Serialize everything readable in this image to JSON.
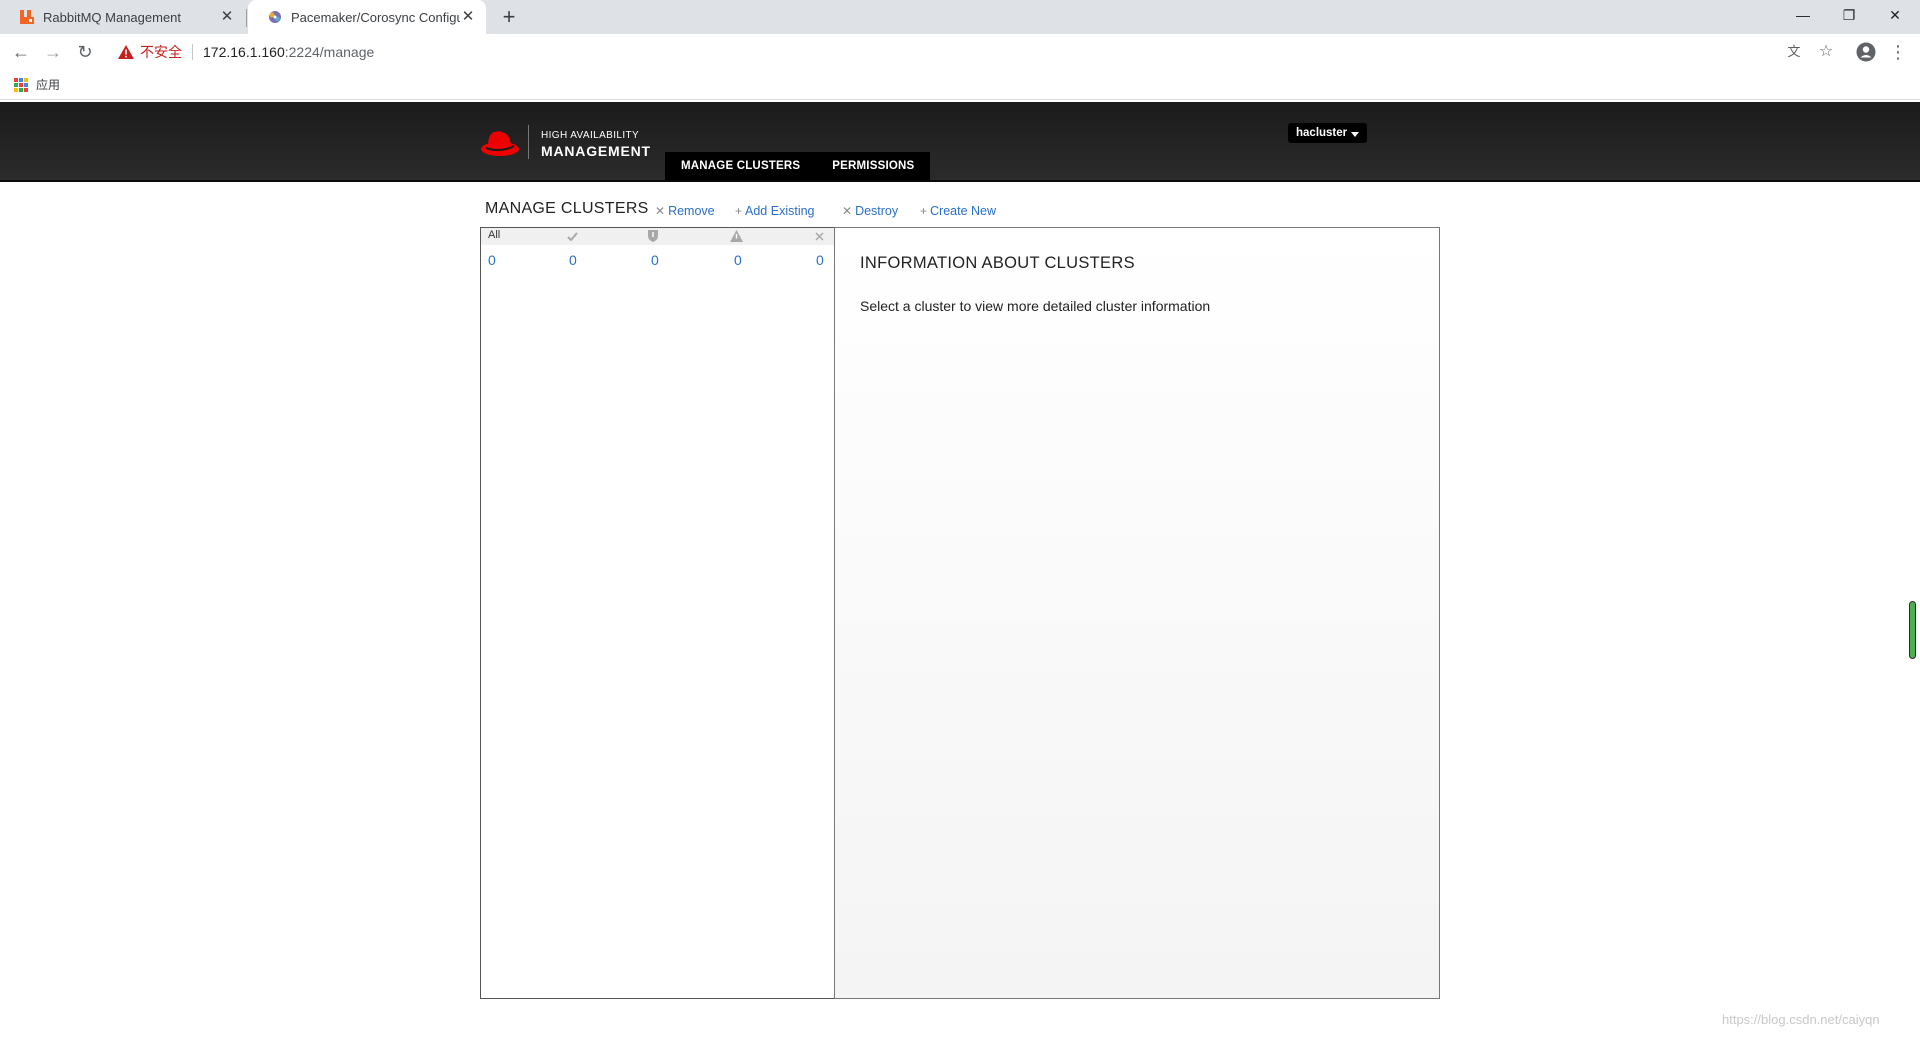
{
  "browser": {
    "tabs": [
      {
        "title": "RabbitMQ Management",
        "active": false,
        "favicon_color": "#f26522"
      },
      {
        "title": "Pacemaker/Corosync Configur",
        "active": true
      }
    ],
    "new_tab": "+",
    "window_controls": {
      "minimize": "—",
      "restore": "❐",
      "close": "✕"
    },
    "security_label": "不安全",
    "url_host": "172.16.1.160",
    "url_path": ":2224/manage",
    "bookmarks": {
      "apps_label": "应用"
    }
  },
  "header": {
    "brand_small": "HIGH AVAILABILITY",
    "brand_big": "MANAGEMENT",
    "nav": [
      "MANAGE CLUSTERS",
      "PERMISSIONS"
    ],
    "user": "hacluster",
    "accent_color": "#ee0000"
  },
  "content": {
    "title": "MANAGE CLUSTERS",
    "actions": [
      {
        "icon": "✕",
        "label": "Remove"
      },
      {
        "icon": "+",
        "label": "Add Existing"
      },
      {
        "icon": "✕",
        "label": "Destroy"
      },
      {
        "icon": "+",
        "label": "Create New"
      }
    ],
    "filters": {
      "all_label": "All",
      "icons": [
        "ok-check-icon",
        "shield-icon",
        "warning-icon",
        "error-x-icon"
      ],
      "counts": [
        "0",
        "0",
        "0",
        "0",
        "0"
      ]
    },
    "info": {
      "title": "INFORMATION ABOUT CLUSTERS",
      "text": "Select a cluster to view more detailed cluster information"
    }
  },
  "watermark": "https://blog.csdn.net/caiyqn"
}
